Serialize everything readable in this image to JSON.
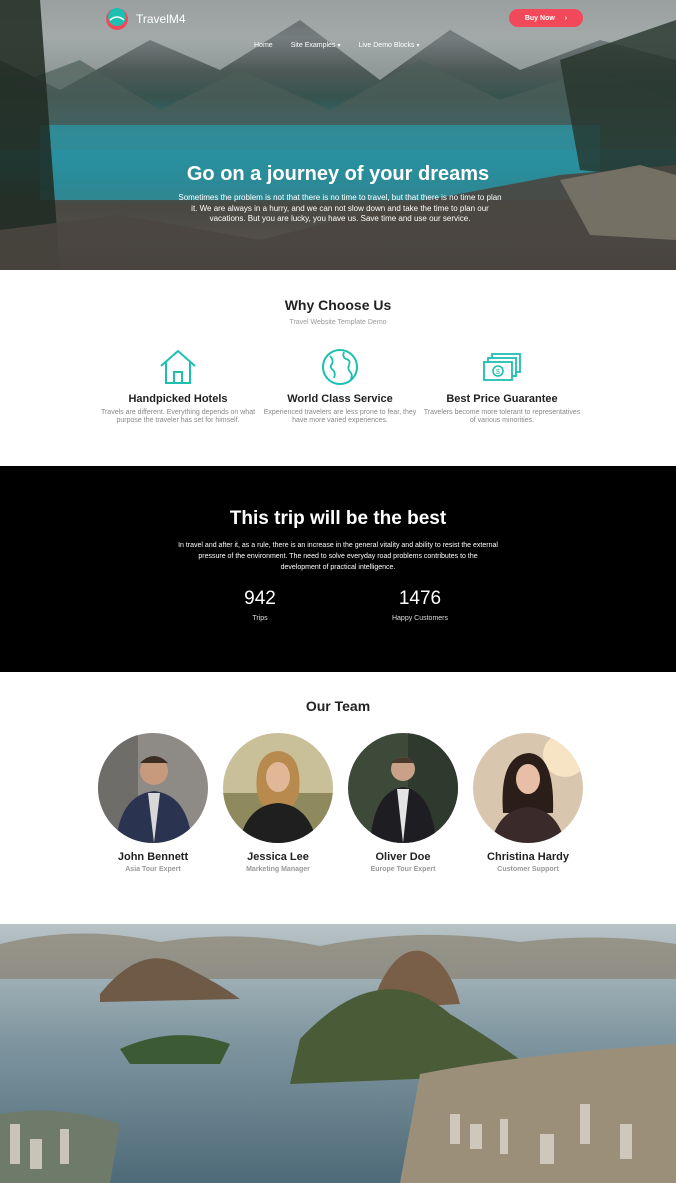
{
  "header": {
    "brand": "TravelM4",
    "nav": [
      {
        "label": "Home",
        "has_caret": false
      },
      {
        "label": "Site Examples",
        "has_caret": true
      },
      {
        "label": "Live Demo Blocks",
        "has_caret": true
      }
    ],
    "buy_button": "Buy Now",
    "accent_color": "#f2495a"
  },
  "hero": {
    "title": "Go on a journey of your dreams",
    "text": "Sometimes the problem is not that there is no time to travel, but that there is no time to plan it. We are always in a hurry, and we can not slow down and take the time to plan our vacations. But you are lucky, you have us. Save time and use our service."
  },
  "why": {
    "title": "Why Choose Us",
    "subtitle": "Travel Website Template Demo",
    "icon_color": "#1cbfb0",
    "features": [
      {
        "icon": "house-icon",
        "title": "Handpicked Hotels",
        "text": "Travels are different. Everything depends on what purpose the traveler has set for himself."
      },
      {
        "icon": "globe-icon",
        "title": "World Class Service",
        "text": "Experienced travelers are less prone to fear, they have more varied experiences."
      },
      {
        "icon": "money-icon",
        "title": "Best Price Guarantee",
        "text": "Travelers become more tolerant to representatives of various minorities."
      }
    ]
  },
  "stats": {
    "title": "This trip will be the best",
    "text": "In travel and after it, as a rule, there is an increase in the general vitality and ability to resist the external pressure of the environment. The need to solve everyday road problems contributes to the development of practical intelligence.",
    "items": [
      {
        "value": "942",
        "label": "Trips"
      },
      {
        "value": "1476",
        "label": "Happy Customers"
      }
    ]
  },
  "team": {
    "title": "Our Team",
    "members": [
      {
        "name": "John Bennett",
        "role": "Asia Tour Expert"
      },
      {
        "name": "Jessica Lee",
        "role": "Marketing Manager"
      },
      {
        "name": "Oliver Doe",
        "role": "Europe Tour Expert"
      },
      {
        "name": "Christina Hardy",
        "role": "Customer Support"
      }
    ]
  }
}
